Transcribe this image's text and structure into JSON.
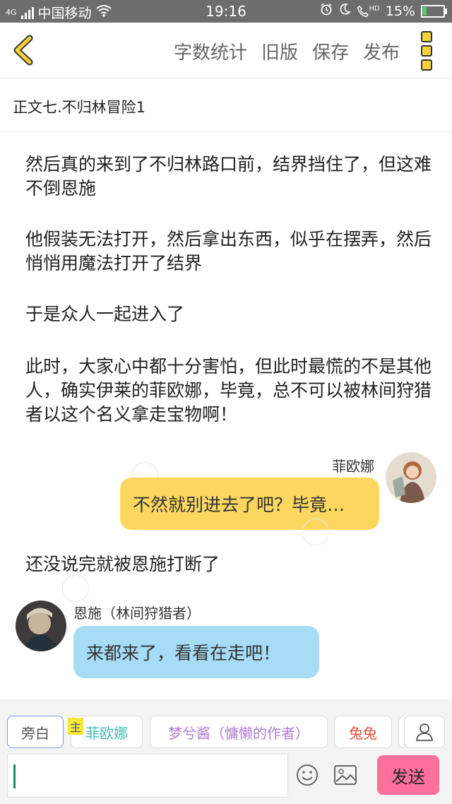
{
  "status_bar": {
    "network": "4G",
    "carrier": "中国移动",
    "time": "19:16",
    "hd": "HD",
    "battery": "15%",
    "battery_level": 0.15
  },
  "toolbar": {
    "word_count": "字数统计",
    "old_version": "旧版",
    "save": "保存",
    "publish": "发布"
  },
  "chapter_title": "正文七.不归林冒险1",
  "narration": [
    "然后真的来到了不归林路口前，结界挡住了，但这难不倒恩施",
    "他假装无法打开，然后拿出东西，似乎在摆弄，然后悄悄用魔法打开了结界",
    "于是众人一起进入了",
    "此时，大家心中都十分害怕，但此时最慌的不是其他人，确实伊莱的菲欧娜，毕竟，总不可以被林间狩猎者以这个名义拿走宝物啊！",
    "还没说完就被恩施打断了"
  ],
  "messages": [
    {
      "speaker": "菲欧娜",
      "text": "不然就别进去了吧？毕竟…",
      "color": "#fcd75f"
    },
    {
      "speaker": "恩施（林间狩猎者）",
      "text": "来都来了，看看在走吧！",
      "color": "#a6dcf6"
    }
  ],
  "roles": {
    "narrator": "旁白",
    "host_tag": "主",
    "fiona": "菲欧娜",
    "author": "梦兮酱（慵懒的作者）",
    "tutu": "兔兔"
  },
  "colors": {
    "fiona": "#3bbfb2",
    "author": "#b07cd6",
    "tutu": "#e0533c",
    "send": "#ff6f9c"
  },
  "send_label": "发送"
}
